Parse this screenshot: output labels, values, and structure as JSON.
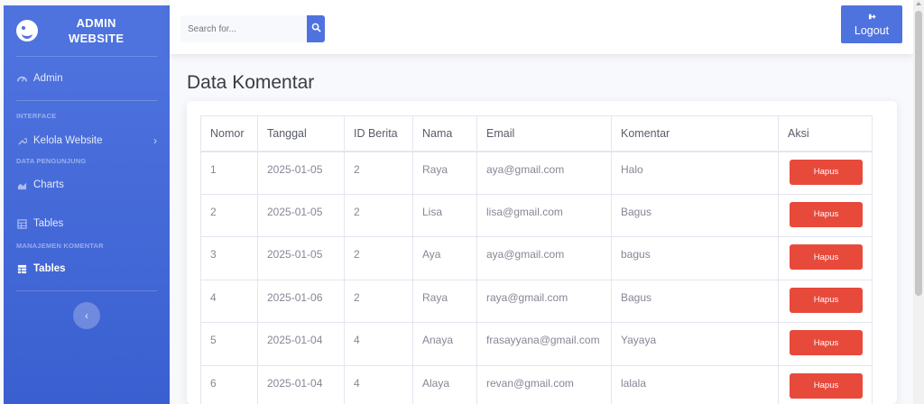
{
  "brand": {
    "line1": "ADMIN",
    "line2": "WEBSITE"
  },
  "sidebar": {
    "items": [
      {
        "label": "Admin"
      },
      {
        "heading": "INTERFACE"
      },
      {
        "label": "Kelola Website"
      },
      {
        "heading": "DATA PENGUNJUNG"
      },
      {
        "label": "Charts"
      },
      {
        "label": "Tables"
      },
      {
        "heading": "MANAJEMEN KOMENTAR"
      },
      {
        "label": "Tables"
      }
    ]
  },
  "search": {
    "placeholder": "Search for..."
  },
  "logout": {
    "label": "Logout"
  },
  "page": {
    "title": "Data Komentar"
  },
  "table": {
    "headers": [
      "Nomor",
      "Tanggal",
      "ID Berita",
      "Nama",
      "Email",
      "Komentar",
      "Aksi"
    ],
    "rows": [
      {
        "nomor": "1",
        "tanggal": "2025-01-05",
        "id_berita": "2",
        "nama": "Raya",
        "email": "aya@gmail.com",
        "komentar": "Halo",
        "aksi": "Hapus"
      },
      {
        "nomor": "2",
        "tanggal": "2025-01-05",
        "id_berita": "2",
        "nama": "Lisa",
        "email": "lisa@gmail.com",
        "komentar": "Bagus",
        "aksi": "Hapus"
      },
      {
        "nomor": "3",
        "tanggal": "2025-01-05",
        "id_berita": "2",
        "nama": "Aya",
        "email": "aya@gmail.com",
        "komentar": "bagus",
        "aksi": "Hapus"
      },
      {
        "nomor": "4",
        "tanggal": "2025-01-06",
        "id_berita": "2",
        "nama": "Raya",
        "email": "raya@gmail.com",
        "komentar": "Bagus",
        "aksi": "Hapus"
      },
      {
        "nomor": "5",
        "tanggal": "2025-01-04",
        "id_berita": "4",
        "nama": "Anaya",
        "email": "frasayyana@gmail.com",
        "komentar": "Yayaya",
        "aksi": "Hapus"
      },
      {
        "nomor": "6",
        "tanggal": "2025-01-04",
        "id_berita": "4",
        "nama": "Alaya",
        "email": "revan@gmail.com",
        "komentar": "lalala",
        "aksi": "Hapus"
      }
    ]
  },
  "colors": {
    "primary": "#4e73df",
    "danger": "#e74a3b",
    "text": "#858796"
  },
  "icons": [
    "smile-logo-icon",
    "tachometer-icon",
    "wrench-icon",
    "chevron-right-icon",
    "chart-area-icon",
    "table-icon",
    "search-icon",
    "sign-out-icon",
    "chevron-left-icon"
  ]
}
